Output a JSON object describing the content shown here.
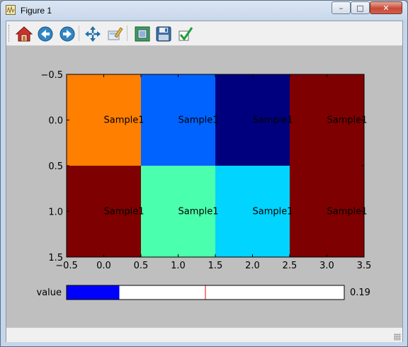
{
  "window": {
    "title": "Figure 1",
    "controls": {
      "minimize": "–",
      "maximize": "□",
      "close": "✕"
    }
  },
  "toolbar": {
    "tools": [
      {
        "name": "home-icon",
        "tooltip": "Reset original view"
      },
      {
        "name": "back-icon",
        "tooltip": "Back to previous view"
      },
      {
        "name": "forward-icon",
        "tooltip": "Forward to next view"
      },
      {
        "name": "pan-icon",
        "tooltip": "Pan axes"
      },
      {
        "name": "zoom-icon",
        "tooltip": "Zoom to rectangle"
      },
      {
        "name": "subplots-icon",
        "tooltip": "Configure subplots"
      },
      {
        "name": "save-icon",
        "tooltip": "Save the figure"
      },
      {
        "name": "edit-check-icon",
        "tooltip": "Edit curves"
      }
    ]
  },
  "slider": {
    "label": "value",
    "value": 0.19,
    "value_text": "0.19",
    "min": 0,
    "max": 1,
    "initial_marker": 0.5,
    "fill_color": "#0000ff",
    "marker_color": "#ff0000"
  },
  "chart_data": {
    "type": "heatmap",
    "title": "",
    "xlabel": "",
    "ylabel": "",
    "xlim": [
      -0.5,
      3.5
    ],
    "ylim": [
      1.5,
      -0.5
    ],
    "x_ticks": [
      -0.5,
      0.0,
      0.5,
      1.0,
      1.5,
      2.0,
      2.5,
      3.0,
      3.5
    ],
    "x_tick_labels": [
      "−0.5",
      "0.0",
      "0.5",
      "1.0",
      "1.5",
      "2.0",
      "2.5",
      "3.0",
      "3.5"
    ],
    "y_ticks": [
      -0.5,
      0.0,
      0.5,
      1.0,
      1.5
    ],
    "y_tick_labels": [
      "−0.5",
      "0.0",
      "0.5",
      "1.0",
      "1.5"
    ],
    "colormap": "jet",
    "cells": [
      [
        {
          "color": "#ff7f00",
          "label": "Sample1"
        },
        {
          "color": "#0063ff",
          "label": "Sample1"
        },
        {
          "color": "#00007f",
          "label": "Sample1"
        },
        {
          "color": "#7f0000",
          "label": "Sample1"
        }
      ],
      [
        {
          "color": "#7f0000",
          "label": "Sample1"
        },
        {
          "color": "#4affad",
          "label": "Sample1"
        },
        {
          "color": "#00d4ff",
          "label": "Sample1"
        },
        {
          "color": "#7f0000",
          "label": "Sample1"
        }
      ]
    ],
    "grid": false,
    "legend": "none"
  }
}
